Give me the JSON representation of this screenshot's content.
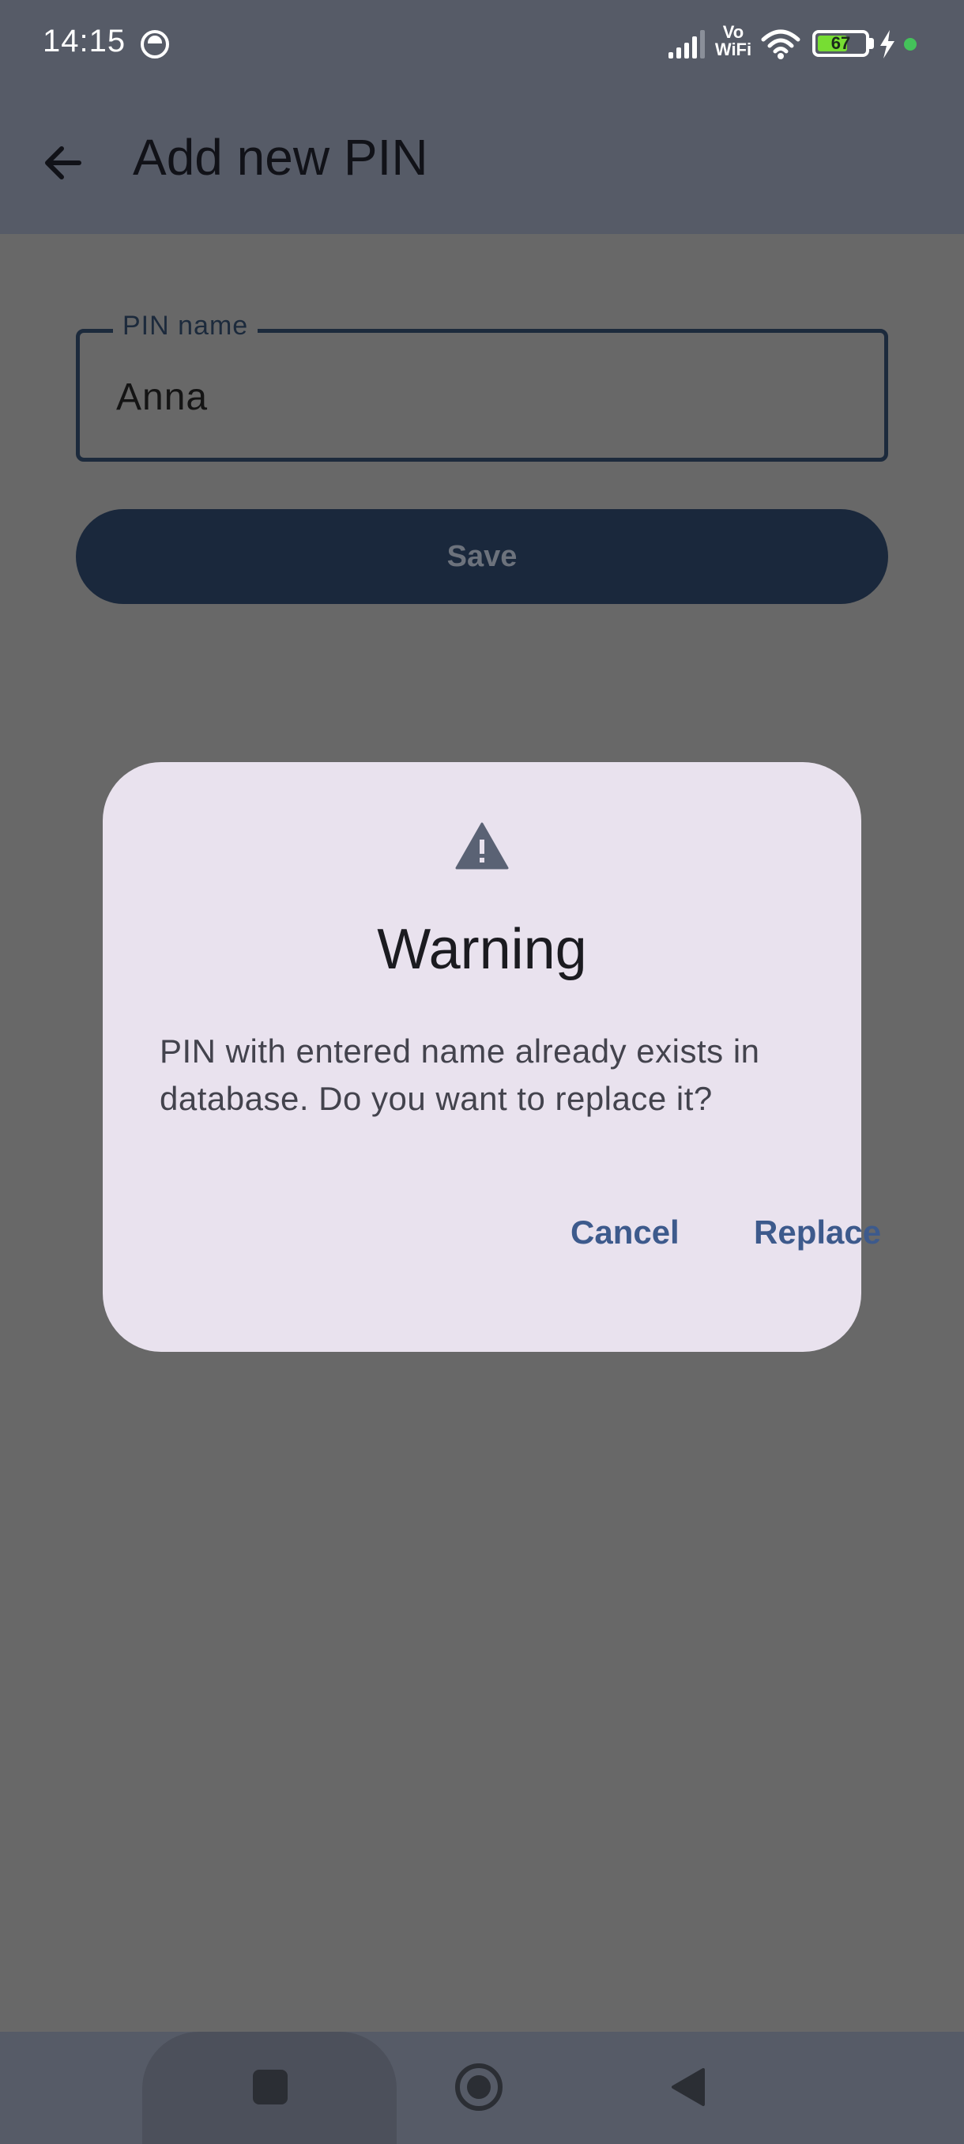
{
  "status_bar": {
    "time": "14:15",
    "battery_percent": "67",
    "battery_level": 0.67,
    "network_label": "Vo WiFi",
    "icons": [
      "face-icon",
      "signal-icon",
      "vowifi-icon",
      "wifi-icon",
      "battery-icon",
      "charging-icon",
      "status-dot"
    ]
  },
  "app_bar": {
    "title": "Add new PIN",
    "back_icon": "arrow-left-icon"
  },
  "form": {
    "pin_name_label": "PIN name",
    "pin_name_value": "Anna",
    "save_label": "Save"
  },
  "dialog": {
    "icon": "warning-icon",
    "title": "Warning",
    "message": "PIN with entered name already exists in database. Do you want to replace it?",
    "cancel_label": "Cancel",
    "replace_label": "Replace"
  },
  "nav_bar": {
    "icons": [
      "recents-icon",
      "home-icon",
      "back-icon"
    ]
  },
  "colors": {
    "scrim": "#686868",
    "bar": "#565b67",
    "dialog": "#e9e2ee",
    "button": "#1a283c",
    "accent": "#3d5a8c"
  }
}
